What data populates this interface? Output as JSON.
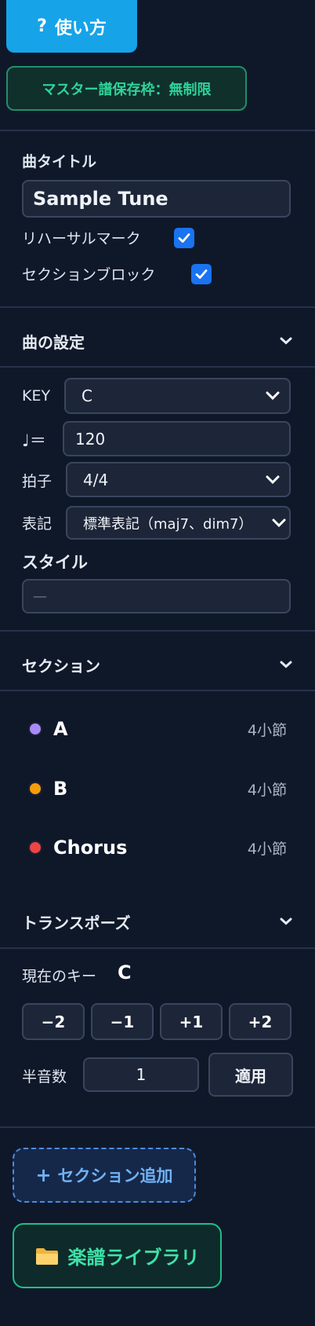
{
  "header": {
    "help_icon": "?",
    "help_label": "使い方",
    "quota_text": "マスター譜保存枠：無制限"
  },
  "song": {
    "title_label": "曲タイトル",
    "title_value": "Sample Tune",
    "rehearsal_label": "リハーサルマーク",
    "rehearsal_checked": true,
    "section_block_label": "セクションブロック",
    "section_block_checked": true
  },
  "settings": {
    "heading": "曲の設定",
    "key_label": "KEY",
    "key_value": "C",
    "tempo_label": "♩＝",
    "tempo_value": "120",
    "meter_label": "拍子",
    "meter_value": "4/4",
    "notation_label": "表記",
    "notation_value": "標準表記（maj7、dim7）",
    "style_label": "スタイル",
    "style_placeholder": "—"
  },
  "sections": {
    "heading": "セクション",
    "items": [
      {
        "name": "A",
        "bars": "4小節",
        "color": "#a78bfa"
      },
      {
        "name": "B",
        "bars": "4小節",
        "color": "#f59e0b"
      },
      {
        "name": "Chorus",
        "bars": "4小節",
        "color": "#ef4444"
      }
    ]
  },
  "transpose": {
    "heading": "トランスポーズ",
    "current_key_label": "現在のキー",
    "current_key_value": "C",
    "buttons": [
      "−2",
      "−1",
      "+1",
      "+2"
    ],
    "semitone_label": "半音数",
    "semitone_value": "1",
    "apply_label": "適用"
  },
  "actions": {
    "add_section_icon": "+",
    "add_section_label": "セクション追加",
    "library_icon": "folder-icon",
    "library_label": "楽譜ライブラリ"
  },
  "colors": {
    "background": "#0f1829",
    "accent_blue": "#16a3e8",
    "checkbox": "#1a73f0",
    "green": "#2fd39a"
  }
}
